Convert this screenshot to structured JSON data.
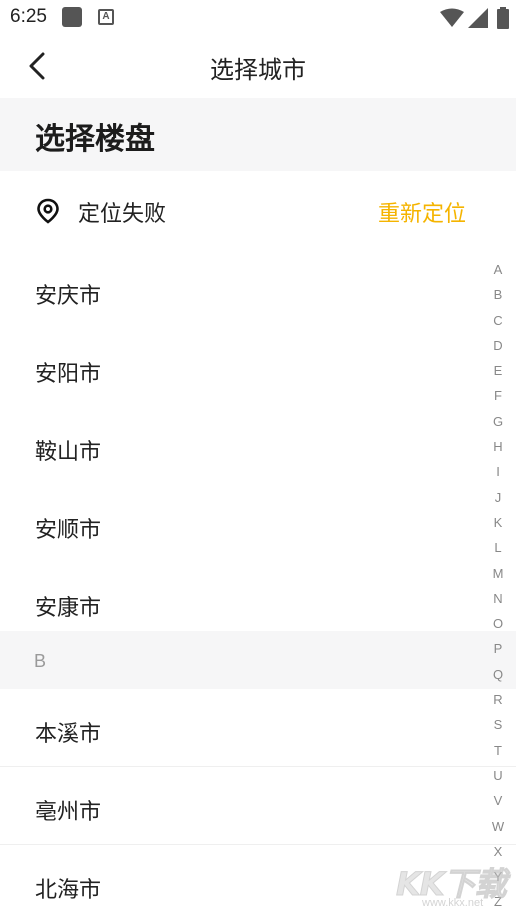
{
  "status_bar": {
    "time": "6:25",
    "icons": [
      "app-notification-icon",
      "a-badge-icon",
      "wifi-icon",
      "signal-icon",
      "battery-icon"
    ],
    "a_badge": "A"
  },
  "header": {
    "title": "选择城市",
    "back_icon": "chevron-left-icon"
  },
  "section": {
    "title": "选择楼盘"
  },
  "location": {
    "icon": "location-pin-icon",
    "status": "定位失败",
    "relocate_label": "重新定位",
    "accent_color": "#f5b400"
  },
  "cities_a": [
    {
      "name": "安庆市"
    },
    {
      "name": "安阳市"
    },
    {
      "name": "鞍山市"
    },
    {
      "name": "安顺市"
    },
    {
      "name": "安康市"
    }
  ],
  "letter_b": "B",
  "cities_b": [
    {
      "name": "本溪市"
    },
    {
      "name": "亳州市"
    },
    {
      "name": "北海市"
    }
  ],
  "alphabet": [
    "A",
    "B",
    "C",
    "D",
    "E",
    "F",
    "G",
    "H",
    "I",
    "J",
    "K",
    "L",
    "M",
    "N",
    "O",
    "P",
    "Q",
    "R",
    "S",
    "T",
    "U",
    "V",
    "W",
    "X",
    "Y",
    "Z"
  ],
  "watermark": {
    "logo": "KK下载",
    "url": "www.kkx.net"
  }
}
